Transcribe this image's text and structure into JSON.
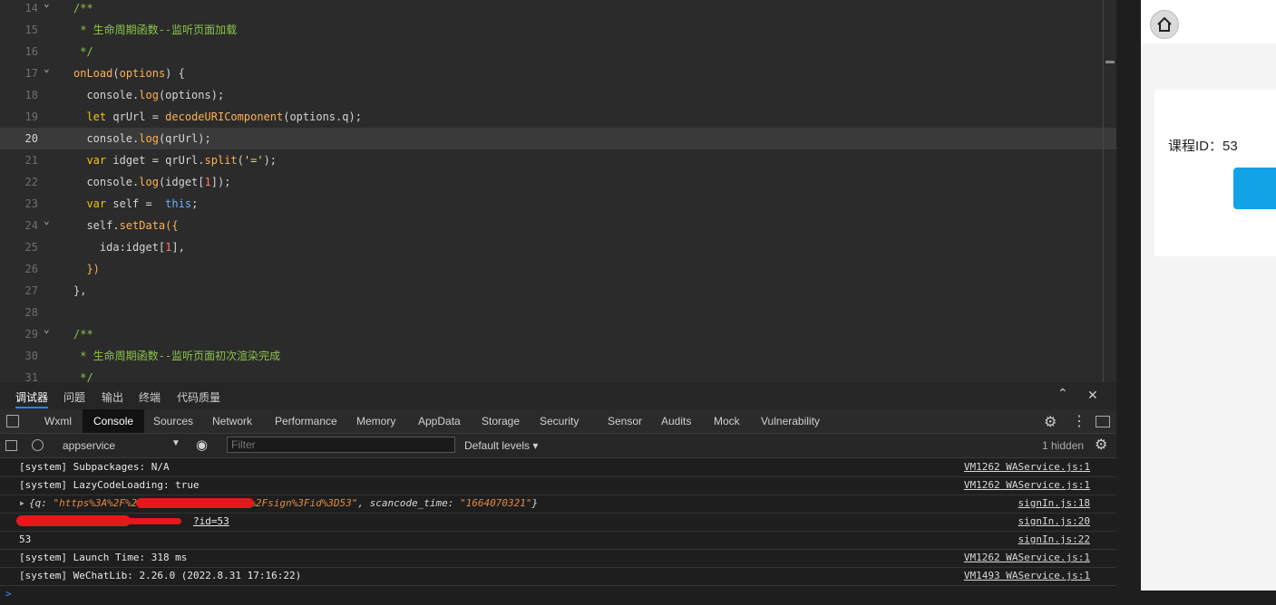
{
  "editor": {
    "lines": [
      {
        "n": "14",
        "fold": true,
        "segments": [
          {
            "t": "/**",
            "c": "cmz"
          }
        ]
      },
      {
        "n": "15",
        "fold": false,
        "segments": [
          {
            "t": " * 生命周期函数--监听页面加载",
            "c": "cmz"
          }
        ]
      },
      {
        "n": "16",
        "fold": false,
        "segments": [
          {
            "t": " */",
            "c": "cmz"
          }
        ]
      },
      {
        "n": "17",
        "fold": true,
        "segments": [
          {
            "t": "onLoad",
            "c": "fn"
          },
          {
            "t": "(",
            "c": ""
          },
          {
            "t": "options",
            "c": "fn"
          },
          {
            "t": ") {",
            "c": ""
          }
        ]
      },
      {
        "n": "18",
        "fold": false,
        "segments": [
          {
            "t": "  console.",
            "c": ""
          },
          {
            "t": "log",
            "c": "fn"
          },
          {
            "t": "(options);",
            "c": ""
          }
        ]
      },
      {
        "n": "19",
        "fold": false,
        "segments": [
          {
            "t": "  ",
            "c": ""
          },
          {
            "t": "let",
            "c": "kw"
          },
          {
            "t": " qrUrl = ",
            "c": ""
          },
          {
            "t": "decodeURIComponent",
            "c": "fn"
          },
          {
            "t": "(options.q);",
            "c": ""
          }
        ]
      },
      {
        "n": "20",
        "fold": false,
        "active": true,
        "segments": [
          {
            "t": "  console.",
            "c": ""
          },
          {
            "t": "log",
            "c": "fn"
          },
          {
            "t": "(qrUrl);",
            "c": ""
          }
        ]
      },
      {
        "n": "21",
        "fold": false,
        "segments": [
          {
            "t": "  ",
            "c": ""
          },
          {
            "t": "var",
            "c": "kw"
          },
          {
            "t": " idget = qrUrl.",
            "c": ""
          },
          {
            "t": "split",
            "c": "fn"
          },
          {
            "t": "(",
            "c": ""
          },
          {
            "t": "'='",
            "c": "str"
          },
          {
            "t": ");",
            "c": ""
          }
        ]
      },
      {
        "n": "22",
        "fold": false,
        "segments": [
          {
            "t": "  console.",
            "c": ""
          },
          {
            "t": "log",
            "c": "fn"
          },
          {
            "t": "(idget[",
            "c": ""
          },
          {
            "t": "1",
            "c": "num"
          },
          {
            "t": "]);",
            "c": ""
          }
        ]
      },
      {
        "n": "23",
        "fold": false,
        "segments": [
          {
            "t": "  ",
            "c": ""
          },
          {
            "t": "var",
            "c": "kw"
          },
          {
            "t": " self =  ",
            "c": ""
          },
          {
            "t": "this",
            "c": "kw2"
          },
          {
            "t": ";",
            "c": ""
          }
        ]
      },
      {
        "n": "24",
        "fold": true,
        "segments": [
          {
            "t": "  self.",
            "c": ""
          },
          {
            "t": "setData",
            "c": "fn"
          },
          {
            "t": "({",
            "c": "fn"
          }
        ]
      },
      {
        "n": "25",
        "fold": false,
        "segments": [
          {
            "t": "    ida:idget[",
            "c": ""
          },
          {
            "t": "1",
            "c": "num"
          },
          {
            "t": "],",
            "c": ""
          }
        ]
      },
      {
        "n": "26",
        "fold": false,
        "segments": [
          {
            "t": "  })",
            "c": "fn"
          }
        ]
      },
      {
        "n": "27",
        "fold": false,
        "segments": [
          {
            "t": "},",
            "c": ""
          }
        ]
      },
      {
        "n": "28",
        "fold": false,
        "segments": []
      },
      {
        "n": "29",
        "fold": true,
        "segments": [
          {
            "t": "/**",
            "c": "cmz"
          }
        ]
      },
      {
        "n": "30",
        "fold": false,
        "segments": [
          {
            "t": " * 生命周期函数--监听页面初次渲染完成",
            "c": "cmz"
          }
        ]
      },
      {
        "n": "31",
        "fold": false,
        "segments": [
          {
            "t": " */",
            "c": "cmz"
          }
        ]
      }
    ]
  },
  "devtools": {
    "top_tabs": [
      "调试器",
      "问题",
      "输出",
      "终端",
      "代码质量"
    ],
    "panel_tabs": [
      "Wxml",
      "Console",
      "Sources",
      "Network",
      "Performance",
      "Memory",
      "AppData",
      "Storage",
      "Security",
      "Sensor",
      "Audits",
      "Mock",
      "Vulnerability"
    ],
    "selected_panel": "Console",
    "context": "appservice",
    "filter_placeholder": "Filter",
    "levels": "Default levels",
    "hidden": "1 hidden",
    "logs": [
      {
        "msg": "[system] Subpackages: N/A",
        "src": "VM1262 WAService.js:1"
      },
      {
        "msg": "[system] LazyCodeLoading: true",
        "src": "VM1262 WAService.js:1"
      },
      {
        "msg_obj": {
          "prefix": "{q: ",
          "q": "\"https%3A%2F%2",
          "q_end": "%2Fsign%3Fid%3D53\"",
          "mid": ", scancode_time: ",
          "time": "\"1664070321\"",
          "suffix": "}"
        },
        "src": "signIn.js:18"
      },
      {
        "msg_link": "?id=53",
        "src": "signIn.js:20"
      },
      {
        "msg": "53",
        "src": "signIn.js:22"
      },
      {
        "msg": "[system] Launch Time: 318 ms",
        "src": "VM1262 WAService.js:1"
      },
      {
        "msg": "[system] WeChatLib: 2.26.0 (2022.8.31 17:16:22)",
        "src": "VM1493 WAService.js:1"
      }
    ],
    "prompt": ">"
  },
  "simulator": {
    "course_label": "课程ID：53"
  },
  "colors": {
    "accent": "#1b8cff",
    "button_blue": "#12a2e6"
  }
}
